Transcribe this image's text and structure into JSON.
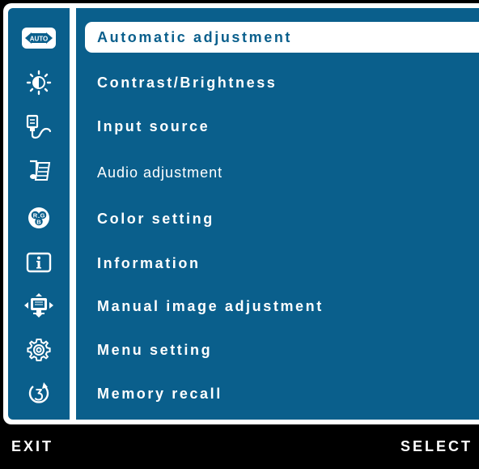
{
  "menu": {
    "items": [
      {
        "label": "Automatic adjustment",
        "icon": "auto-icon",
        "selected": true
      },
      {
        "label": "Contrast/Brightness",
        "icon": "brightness-icon"
      },
      {
        "label": "Input source",
        "icon": "input-source-icon"
      },
      {
        "label": "Audio adjustment",
        "icon": "audio-icon"
      },
      {
        "label": "Color setting",
        "icon": "rgb-color-icon"
      },
      {
        "label": "Information",
        "icon": "info-icon"
      },
      {
        "label": "Manual image adjustment",
        "icon": "image-adjust-icon"
      },
      {
        "label": "Menu setting",
        "icon": "gear-icon"
      },
      {
        "label": "Memory recall",
        "icon": "recall-icon"
      }
    ],
    "auto_icon_text": "AUTO",
    "rgb_icon_text": {
      "r": "R",
      "g": "G",
      "b": "B"
    }
  },
  "footer": {
    "exit_label": "EXIT",
    "select_label": "SELECT"
  },
  "colors": {
    "panel_blue": "#0a5f8c",
    "frame_white": "#ffffff",
    "background": "#000000"
  }
}
